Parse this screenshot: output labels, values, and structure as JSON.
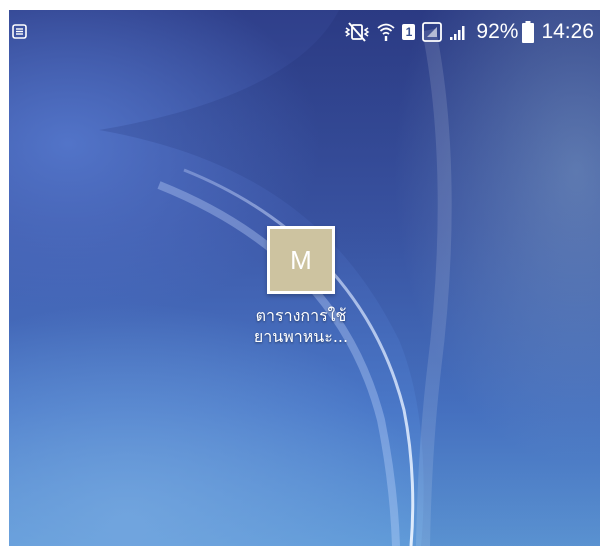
{
  "status_bar": {
    "notification_icon": "notification-list-icon",
    "icons": [
      "mute-vibrate-icon",
      "wifi-icon",
      "sim-card-icon",
      "signal-roaming-icon",
      "signal-bars-icon",
      "battery-icon"
    ],
    "sim_label": "1",
    "battery_percent": "92%",
    "battery_level": 0.92,
    "time": "14:26"
  },
  "home_screen": {
    "app_icon_letter": "M",
    "app_icon_color": "#cdc3a0",
    "app_label": "ตารางการใช้\nยานพาหนะ..."
  }
}
